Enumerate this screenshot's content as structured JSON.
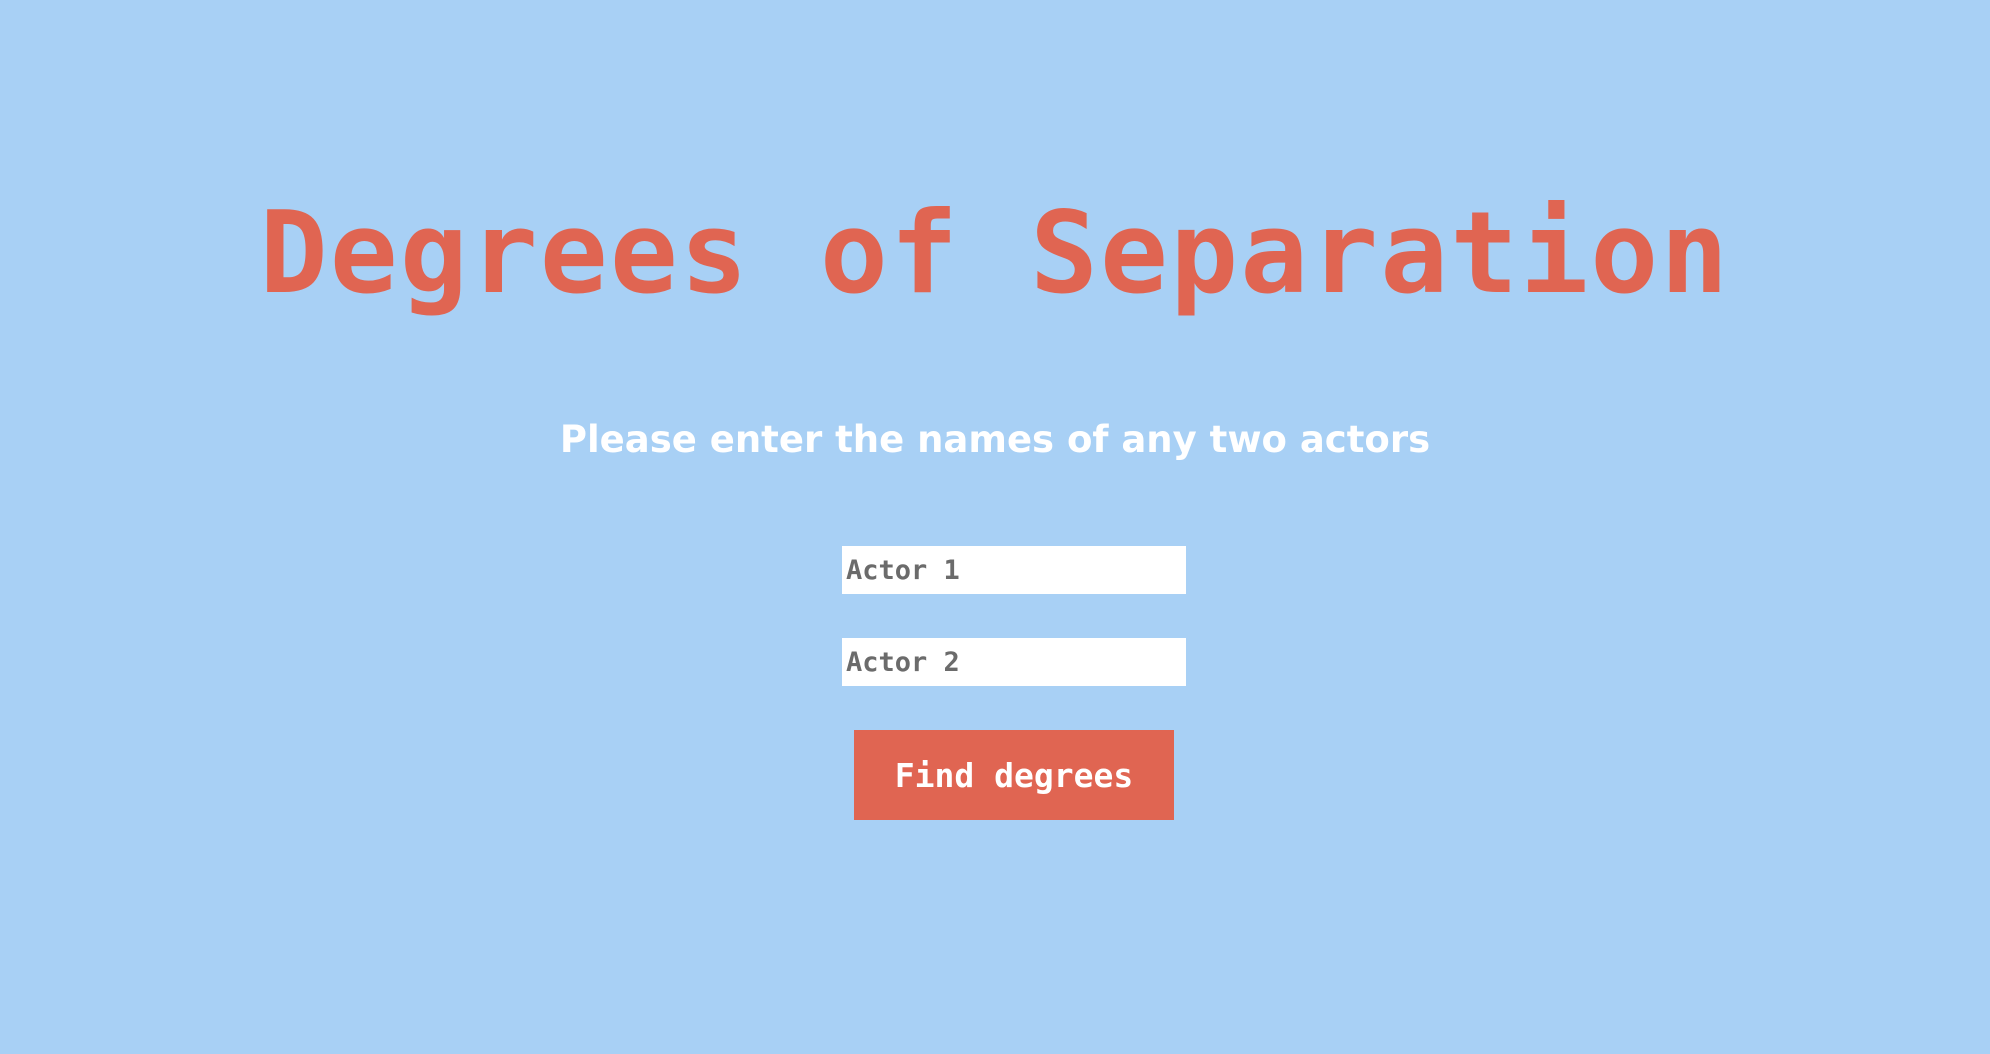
{
  "header": {
    "title": "Degrees of Separation",
    "instruction": "Please enter the names of any two actors"
  },
  "form": {
    "actor1": {
      "value": "",
      "placeholder": "Actor 1"
    },
    "actor2": {
      "value": "",
      "placeholder": "Actor 2"
    },
    "submit_label": "Find degrees"
  },
  "colors": {
    "background": "#a8d0f5",
    "accent": "#e06552",
    "subtitle": "#ffffff",
    "input_background": "#ffffff"
  }
}
